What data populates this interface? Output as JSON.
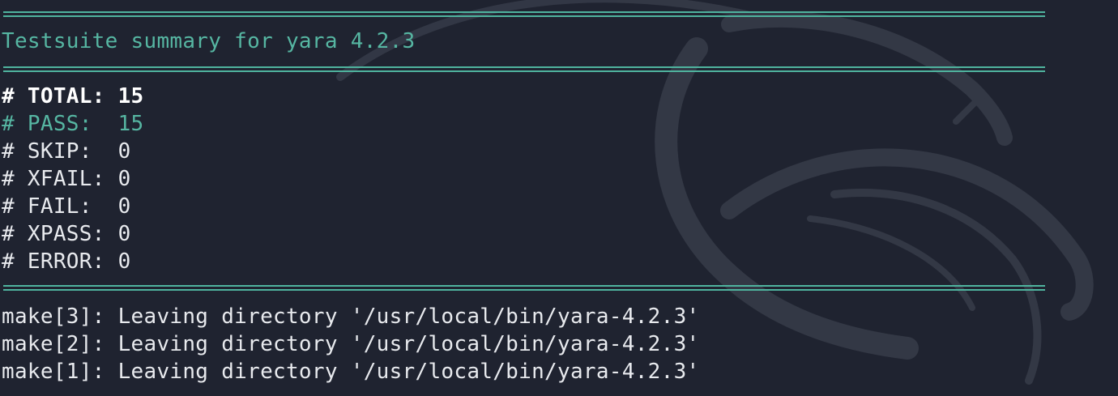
{
  "terminal": {
    "summary_title": "Testsuite summary for yara 4.2.3",
    "results": [
      {
        "label": "# TOTAL: ",
        "value": "15"
      },
      {
        "label": "# PASS:  ",
        "value": "15"
      },
      {
        "label": "# SKIP:  ",
        "value": "0"
      },
      {
        "label": "# XFAIL: ",
        "value": "0"
      },
      {
        "label": "# FAIL:  ",
        "value": "0"
      },
      {
        "label": "# XPASS: ",
        "value": "0"
      },
      {
        "label": "# ERROR: ",
        "value": "0"
      }
    ],
    "make_lines": [
      "make[3]: Leaving directory '/usr/local/bin/yara-4.2.3'",
      "make[2]: Leaving directory '/usr/local/bin/yara-4.2.3'",
      "make[1]: Leaving directory '/usr/local/bin/yara-4.2.3'"
    ]
  },
  "colors": {
    "background": "#1f2330",
    "accent_teal": "#56b6a2",
    "text": "#e8eaee"
  },
  "icons": {
    "background": "kali-dragon-watermark"
  }
}
